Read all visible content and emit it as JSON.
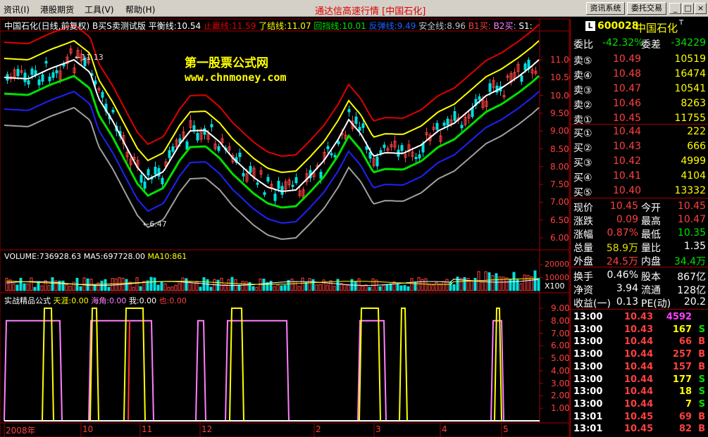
{
  "menu": {
    "items": [
      {
        "label": "资讯(I)",
        "key": "I"
      },
      {
        "label": "港股期货",
        "key": ""
      },
      {
        "label": "工具(V)",
        "key": "V"
      },
      {
        "label": "帮助(H)",
        "key": "H"
      }
    ]
  },
  "title": "通达信高速行情 [中国石化]",
  "toolbar": {
    "info_btn": "资讯系统",
    "trade_btn": "委托交易"
  },
  "window_controls": {
    "min": "_",
    "max": "□",
    "close": "×"
  },
  "chart_header": {
    "name": "中国石化(日线,前复权)",
    "formula": "B买S卖测试版",
    "balance_label": "平衡线:",
    "balance": "10.54",
    "stop_profit_label": "止赢线:",
    "stop_profit": "11.59",
    "close_label": "了结线:",
    "close": "11.07",
    "pullback_label": "回挡线:",
    "pullback": "10.01",
    "rebound_label": "反弹线:",
    "rebound": "9.49",
    "safe_label": "安全线:",
    "safe": "8.96",
    "b1_label": "B1买:",
    "b2_label": "B2买:",
    "s1_label": "S1:"
  },
  "watermark": {
    "line1": "第一股票公式网",
    "line2": "www.chnmoney.com"
  },
  "annotations": {
    "high": "←11.13",
    "low": "←6.47"
  },
  "volume_header": {
    "label": "VOLUME:",
    "value": "736928.63",
    "ma5_label": "MA5:",
    "ma5": "697728.00",
    "ma10_label": "MA10:",
    "ma10": "861"
  },
  "indicator_header": {
    "name": "实战精品公式",
    "tianya_label": "天涯:",
    "tianya": "0.00",
    "haijiao_label": "海角:",
    "haijiao": "0.00",
    "wo_label": "我:",
    "wo": "0.00",
    "ye_label": "也:",
    "ye": "0.00"
  },
  "axis_labels": {
    "price": [
      "11.00",
      "10.50",
      "10.00",
      "9.50",
      "9.00",
      "8.50",
      "8.00",
      "7.50",
      "7.00",
      "6.50",
      "6.00"
    ],
    "volume": [
      "20000",
      "10000"
    ],
    "volume_unit": "X100",
    "indicator": [
      "9.00",
      "8.00",
      "7.00",
      "6.00",
      "5.00",
      "4.00",
      "3.00",
      "2.00",
      "1.00"
    ],
    "time": [
      "2008年",
      "10",
      "11",
      "12",
      "2",
      "3",
      "4",
      "5"
    ]
  },
  "quote": {
    "badge": "L",
    "code": "600028",
    "name": "中国石化",
    "suffix": "T",
    "weibi_label": "委比",
    "weibi": "-42.32%",
    "weicha_label": "委差",
    "weicha": "-34229",
    "asks": [
      {
        "label": "卖⑤",
        "price": "10.49",
        "vol": "10519"
      },
      {
        "label": "卖④",
        "price": "10.48",
        "vol": "16474"
      },
      {
        "label": "卖③",
        "price": "10.47",
        "vol": "10541"
      },
      {
        "label": "卖②",
        "price": "10.46",
        "vol": "8263"
      },
      {
        "label": "卖①",
        "price": "10.45",
        "vol": "11755"
      }
    ],
    "bids": [
      {
        "label": "买①",
        "price": "10.44",
        "vol": "222"
      },
      {
        "label": "买②",
        "price": "10.43",
        "vol": "666"
      },
      {
        "label": "买③",
        "price": "10.42",
        "vol": "4999"
      },
      {
        "label": "买④",
        "price": "10.41",
        "vol": "4104"
      },
      {
        "label": "买⑤",
        "price": "10.40",
        "vol": "13332"
      }
    ],
    "stats": [
      {
        "l1": "现价",
        "v1": "10.45",
        "l2": "今开",
        "v2": "10.45",
        "c1": "#ff4040",
        "c2": "#ff4040"
      },
      {
        "l1": "涨跌",
        "v1": "0.09",
        "l2": "最高",
        "v2": "10.47",
        "c1": "#ff4040",
        "c2": "#ff4040"
      },
      {
        "l1": "涨幅",
        "v1": "0.87%",
        "l2": "最低",
        "v2": "10.35",
        "c1": "#ff4040",
        "c2": "#00e000"
      },
      {
        "l1": "总量",
        "v1": "58.9万",
        "l2": "量比",
        "v2": "1.35",
        "c1": "#e0e000",
        "c2": "#ffffff"
      },
      {
        "l1": "外盘",
        "v1": "24.5万",
        "l2": "内盘",
        "v2": "34.4万",
        "c1": "#ff4040",
        "c2": "#00e000"
      }
    ],
    "stats2": [
      {
        "l1": "换手",
        "v1": "0.46%",
        "l2": "股本",
        "v2": "867亿"
      },
      {
        "l1": "净资",
        "v1": "3.94",
        "l2": "流通",
        "v2": "128亿"
      },
      {
        "l1": "收益(一)",
        "v1": "0.13",
        "l2": "PE(动)",
        "v2": "20.2"
      }
    ]
  },
  "ticks": [
    {
      "t": "13:00",
      "p": "10.43",
      "v": "4592",
      "f": ""
    },
    {
      "t": "13:00",
      "p": "10.43",
      "v": "167",
      "f": "S"
    },
    {
      "t": "13:00",
      "p": "10.44",
      "v": "66",
      "f": "B"
    },
    {
      "t": "13:00",
      "p": "10.44",
      "v": "257",
      "f": "B"
    },
    {
      "t": "13:00",
      "p": "10.44",
      "v": "157",
      "f": "B"
    },
    {
      "t": "13:00",
      "p": "10.44",
      "v": "177",
      "f": "S"
    },
    {
      "t": "13:00",
      "p": "10.44",
      "v": "18",
      "f": "S"
    },
    {
      "t": "13:00",
      "p": "10.44",
      "v": "7",
      "f": "S"
    },
    {
      "t": "13:01",
      "p": "10.45",
      "v": "69",
      "f": "B"
    },
    {
      "t": "13:01",
      "p": "10.45",
      "v": "82",
      "f": "B"
    }
  ],
  "colors": {
    "up": "#ff4040",
    "down": "#00e0e0",
    "stop_profit": "#e00000",
    "close": "#ffff00",
    "balance": "#ffffff",
    "pullback": "#00e000",
    "rebound": "#2020ff",
    "safe": "#a0a0a0",
    "tianya": "#ffff00",
    "haijiao": "#ff80ff",
    "wo": "#ffffff",
    "ye": "#ff0000"
  }
}
